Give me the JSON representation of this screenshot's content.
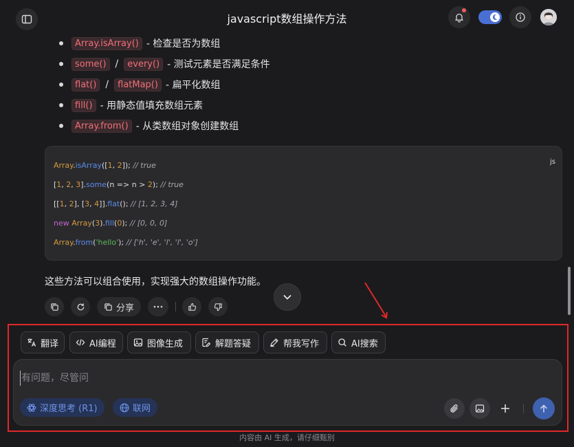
{
  "header": {
    "title": "javascript数组操作方法",
    "icons": [
      "sidebar-toggle-icon",
      "bell-icon",
      "theme-toggle",
      "info-icon",
      "avatar"
    ]
  },
  "bullets": [
    {
      "tags": [
        "Array.isArray()"
      ],
      "desc": "- 检查是否为数组"
    },
    {
      "tags": [
        "some()",
        "every()"
      ],
      "desc": "- 测试元素是否满足条件"
    },
    {
      "tags": [
        "flat()",
        "flatMap()"
      ],
      "desc": "- 扁平化数组"
    },
    {
      "tags": [
        "fill()"
      ],
      "desc": "- 用静态值填充数组元素"
    },
    {
      "tags": [
        "Array.from()"
      ],
      "desc": "- 从类数组对象创建数组"
    }
  ],
  "code": {
    "lang": "js",
    "lines": [
      "Array.isArray([1, 2]); // true",
      "[1, 2, 3].some(n => n > 2); // true",
      "[[1, 2], [3, 4]].flat(); // [1, 2, 3, 4]",
      "new Array(3).fill(0); // [0, 0, 0]",
      "Array.from('hello'); // ['h', 'e', 'l', 'l', 'o']"
    ]
  },
  "summary": "这些方法可以组合使用，实现强大的数组操作功能。",
  "actions": {
    "share_label": "分享"
  },
  "toolbar": [
    {
      "label": "翻译",
      "icon": "translate-icon"
    },
    {
      "label": "AI编程",
      "icon": "code-icon"
    },
    {
      "label": "图像生成",
      "icon": "image-icon"
    },
    {
      "label": "解题答疑",
      "icon": "edit-icon"
    },
    {
      "label": "帮我写作",
      "icon": "pen-icon"
    },
    {
      "label": "AI搜索",
      "icon": "search-icon"
    }
  ],
  "input": {
    "placeholder": "有问题，尽管问"
  },
  "options": {
    "deep_think": "深度思考 (R1)",
    "web": "联网"
  },
  "footer": "内容由 AI 生成，请仔细甄别",
  "colors": {
    "accent": "#3f62b0",
    "annotation": "#e0282a",
    "tag_text": "#f16e7a",
    "notification_dot": "#f25b5b"
  }
}
